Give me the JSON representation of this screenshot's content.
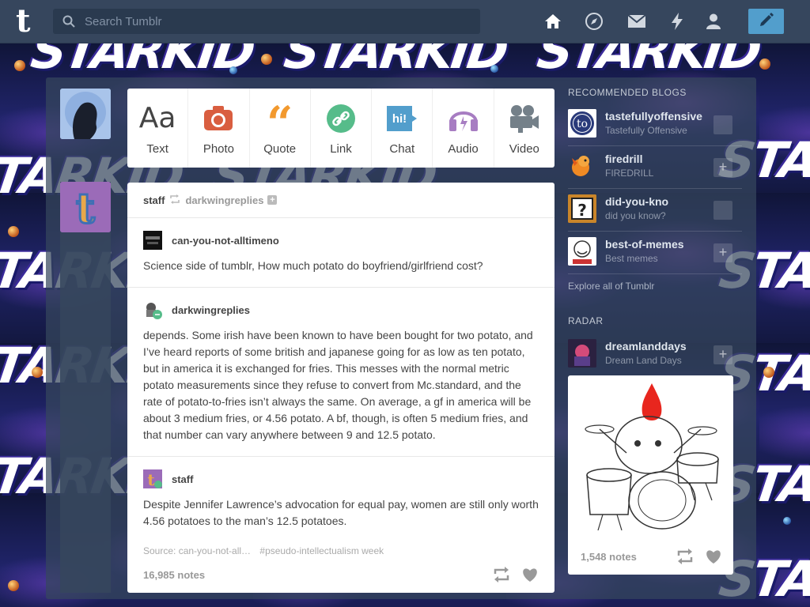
{
  "nav": {
    "search_placeholder": "Search Tumblr",
    "icons": [
      "home-icon",
      "explore-icon",
      "inbox-icon",
      "activity-icon",
      "account-icon",
      "compose-icon"
    ]
  },
  "background": {
    "banner_text": "STARKID"
  },
  "post_types": [
    {
      "label": "Text",
      "icon": "Aa",
      "color": "#444444"
    },
    {
      "label": "Photo",
      "icon": "camera-icon",
      "color": "#d95e40"
    },
    {
      "label": "Quote",
      "icon": "66",
      "color": "#f2992e"
    },
    {
      "label": "Link",
      "icon": "link-icon",
      "color": "#56bc8a"
    },
    {
      "label": "Chat",
      "icon": "hi!",
      "color": "#529ecc"
    },
    {
      "label": "Audio",
      "icon": "audio-icon",
      "color": "#a77dc2"
    },
    {
      "label": "Video",
      "icon": "video-icon",
      "color": "#748089"
    }
  ],
  "post": {
    "author": "staff",
    "reblogged_from": "darkwingreplies",
    "entries": [
      {
        "user": "can-you-not-alltimeno",
        "text": "Science side of tumblr, How much potato do boyfriend/girlfriend cost?"
      },
      {
        "user": "darkwingreplies",
        "text": "depends. Some irish have been known to have been bought for two potato, and I’ve heard reports of some british and japanese going for as low as ten potato, but in america it is exchanged for fries. This messes with the normal metric potato measurements since they refuse to convert from Mc.standard, and the rate of potato-to-fries isn’t always the same. On average, a gf in america will be about 3 medium fries, or 4.56 potato. A bf, though, is often 5 medium fries, and that number can vary anywhere between 9 and 12.5 potato."
      },
      {
        "user": "staff",
        "text": "Despite Jennifer Lawrence’s advocation for equal pay, women are still only worth 4.56 potatoes to the man’s 12.5 potatoes."
      }
    ],
    "source": "Source: can-you-not-all…",
    "tag": "#pseudo-intellectualism week",
    "notes": "16,985 notes"
  },
  "sidebar": {
    "recommended_title": "RECOMMENDED BLOGS",
    "blogs": [
      {
        "name": "tastefullyoffensive",
        "subtitle": "Tastefully Offensive",
        "follow": ""
      },
      {
        "name": "firedrill",
        "subtitle": "FIREDRILL",
        "follow": "+"
      },
      {
        "name": "did-you-kno",
        "subtitle": "did you know?",
        "follow": ""
      },
      {
        "name": "best-of-memes",
        "subtitle": "Best memes",
        "follow": "+"
      }
    ],
    "explore_label": "Explore all of Tumblr",
    "radar_title": "RADAR",
    "radar": {
      "name": "dreamlanddays",
      "subtitle": "Dream Land Days",
      "follow": "+",
      "notes": "1,548 notes"
    }
  },
  "colors": {
    "nav_bg": "#36465d",
    "accent": "#529ecc"
  }
}
